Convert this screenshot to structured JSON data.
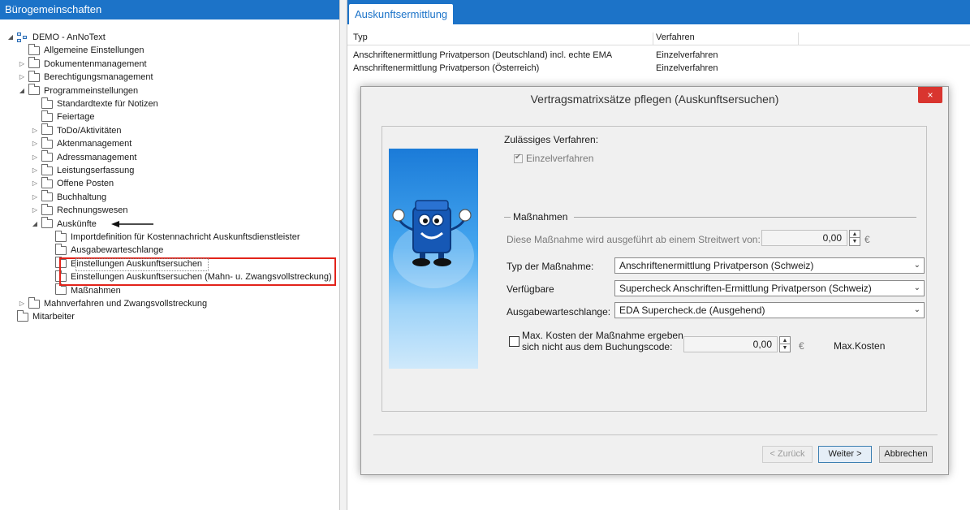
{
  "left_panel": {
    "title": "Bürogemeinschaften",
    "tree": [
      {
        "label": "DEMO - AnNoText",
        "level": 0,
        "expander": "open",
        "icon": "org"
      },
      {
        "label": "Allgemeine Einstellungen",
        "level": 1,
        "expander": "none",
        "icon": "folder"
      },
      {
        "label": "Dokumentenmanagement",
        "level": 1,
        "expander": "closed",
        "icon": "folder"
      },
      {
        "label": "Berechtigungsmanagement",
        "level": 1,
        "expander": "closed",
        "icon": "folder"
      },
      {
        "label": "Programmeinstellungen",
        "level": 1,
        "expander": "open",
        "icon": "folder"
      },
      {
        "label": "Standardtexte für Notizen",
        "level": 2,
        "expander": "none",
        "icon": "folder"
      },
      {
        "label": "Feiertage",
        "level": 2,
        "expander": "none",
        "icon": "folder"
      },
      {
        "label": "ToDo/Aktivitäten",
        "level": 2,
        "expander": "closed",
        "icon": "folder"
      },
      {
        "label": "Aktenmanagement",
        "level": 2,
        "expander": "closed",
        "icon": "folder"
      },
      {
        "label": "Adressmanagement",
        "level": 2,
        "expander": "closed",
        "icon": "folder"
      },
      {
        "label": "Leistungserfassung",
        "level": 2,
        "expander": "closed",
        "icon": "folder"
      },
      {
        "label": "Offene Posten",
        "level": 2,
        "expander": "closed",
        "icon": "folder"
      },
      {
        "label": "Buchhaltung",
        "level": 2,
        "expander": "closed",
        "icon": "folder"
      },
      {
        "label": "Rechnungswesen",
        "level": 2,
        "expander": "closed",
        "icon": "folder"
      },
      {
        "label": "Auskünfte",
        "level": 2,
        "expander": "open",
        "icon": "folder"
      },
      {
        "label": "Importdefinition für Kostennachricht Auskunftsdienstleister",
        "level": 3,
        "expander": "none",
        "icon": "folder"
      },
      {
        "label": "Ausgabewarteschlange",
        "level": 3,
        "expander": "none",
        "icon": "folder"
      },
      {
        "label": "Einstellungen Auskunftsersuchen",
        "level": 3,
        "expander": "none",
        "icon": "folder"
      },
      {
        "label": "Einstellungen Auskunftsersuchen (Mahn- u. Zwangsvollstreckung)",
        "level": 3,
        "expander": "none",
        "icon": "folder"
      },
      {
        "label": "Maßnahmen",
        "level": 3,
        "expander": "none",
        "icon": "folder"
      },
      {
        "label": "Mahnverfahren und Zwangsvollstreckung",
        "level": 1,
        "expander": "closed",
        "icon": "folder"
      },
      {
        "label": "Mitarbeiter",
        "level": 0,
        "expander": "none",
        "icon": "folder"
      }
    ]
  },
  "right_panel": {
    "tab": "Auskunftsermittlung",
    "grid": {
      "headers": [
        "Typ",
        "Verfahren"
      ],
      "rows": [
        [
          "Anschriftenermittlung Privatperson (Deutschland) incl. echte EMA",
          "Einzelverfahren"
        ],
        [
          "Anschriftenermittlung Privatperson (Österreich)",
          "Einzelverfahren"
        ]
      ]
    }
  },
  "dialog": {
    "title": "Vertragsmatrixsätze pflegen (Auskunftsersuchen)",
    "close_glyph": "×",
    "verfahren_label": "Zulässiges Verfahren:",
    "einzelverfahren_label": "Einzelverfahren",
    "einzelverfahren_checked": true,
    "massnahmen_section": "Maßnahmen",
    "streitwert_label": "Diese Maßnahme wird ausgeführt ab einem Streitwert von:",
    "streitwert_value": "0,00",
    "currency": "€",
    "typ_label": "Typ der Maßnahme:",
    "typ_value": "Anschriftenermittlung Privatperson (Schweiz)",
    "verfuegbare_label": "Verfügbare",
    "verfuegbare_value": "Supercheck Anschriften-Ermittlung Privatperson (Schweiz)",
    "ausgabe_label": "Ausgabewarteschlange:",
    "ausgabe_value": "EDA Supercheck.de (Ausgehend)",
    "maxkosten_checkbox_label_line1": "Max. Kosten der Maßnahme ergeben",
    "maxkosten_checkbox_label_line2": "sich nicht aus dem Buchungscode:",
    "maxkosten_checked": false,
    "maxkosten_value": "0,00",
    "maxkosten_label": "Max.Kosten",
    "buttons": {
      "back": "< Zurück",
      "next": "Weiter >",
      "cancel": "Abbrechen"
    }
  },
  "colors": {
    "header_blue": "#1c73c8",
    "highlight_red": "#e2231a",
    "close_red": "#d9352f"
  }
}
